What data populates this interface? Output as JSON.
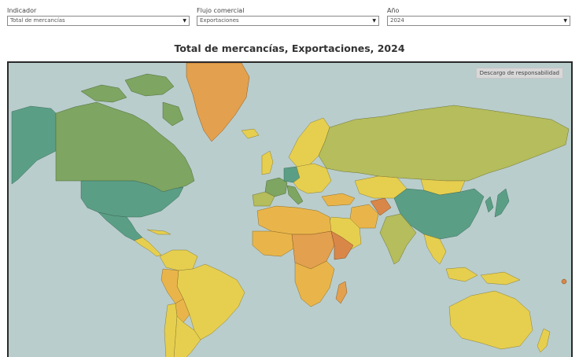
{
  "filters": [
    {
      "label": "Indicador",
      "value": "Total de mercancías"
    },
    {
      "label": "Flujo comercial",
      "value": "Exportaciones"
    },
    {
      "label": "Año",
      "value": "2024"
    }
  ],
  "title": "Total de mercancías, Exportaciones, 2024",
  "disclaimer": "Descargo de responsabilidad",
  "colors": {
    "ocean": "#b9cdcc",
    "dark_green": "#5b9e86",
    "mid_green": "#7ea561",
    "olive": "#b5bd5c",
    "yellow": "#e6cf4f",
    "light_orange": "#e9b54a",
    "orange": "#e3a04e",
    "deep_orange": "#d98748"
  },
  "regions": [
    {
      "name": "Canada",
      "tone": "mid_green"
    },
    {
      "name": "United States",
      "tone": "dark_green"
    },
    {
      "name": "Alaska",
      "tone": "dark_green"
    },
    {
      "name": "Greenland",
      "tone": "orange"
    },
    {
      "name": "China",
      "tone": "dark_green"
    },
    {
      "name": "Russia",
      "tone": "olive"
    },
    {
      "name": "India",
      "tone": "olive"
    },
    {
      "name": "Australia",
      "tone": "yellow"
    }
  ]
}
